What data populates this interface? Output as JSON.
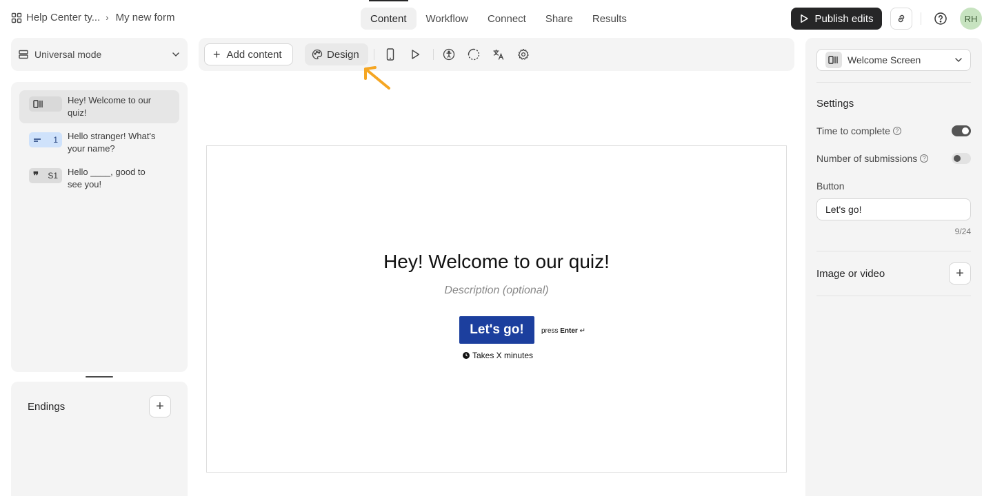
{
  "topbar": {
    "workspace": "Help Center ty...",
    "form_name": "My new form",
    "tabs": [
      "Content",
      "Workflow",
      "Connect",
      "Share",
      "Results"
    ],
    "active_tab": "Content",
    "publish_label": "Publish edits",
    "avatar_initials": "RH"
  },
  "left": {
    "mode_label": "Universal mode",
    "questions": [
      {
        "badge": "",
        "badge_icon": "welcome-screen-icon",
        "text": "Hey! Welcome to our quiz!",
        "active": true
      },
      {
        "badge": "1",
        "badge_icon": "short-text-icon",
        "text": "Hello stranger! What's your name?",
        "active": false
      },
      {
        "badge": "S1",
        "badge_icon": "statement-icon",
        "text": "Hello ____, good to see you!",
        "active": false
      }
    ],
    "endings_label": "Endings"
  },
  "toolbar": {
    "add_content": "Add content",
    "design": "Design"
  },
  "canvas": {
    "title": "Hey! Welcome to our quiz!",
    "description": "Description (optional)",
    "button": "Let's go!",
    "press_prefix": "press",
    "press_key": "Enter",
    "takes": "Takes X minutes"
  },
  "right": {
    "screen_type": "Welcome Screen",
    "settings_heading": "Settings",
    "time_to_complete": "Time to complete",
    "time_to_complete_on": true,
    "number_of_submissions": "Number of submissions",
    "number_of_submissions_on": false,
    "button_label": "Button",
    "button_value": "Let's go!",
    "button_counter": "9/24",
    "image_or_video": "Image or video"
  },
  "colors": {
    "primary_dark": "#262627",
    "cta_blue": "#1c3f9e",
    "annotation_arrow": "#f5a623",
    "short_text_badge": "#cfe2fb",
    "avatar_bg": "#c7e3c0"
  }
}
